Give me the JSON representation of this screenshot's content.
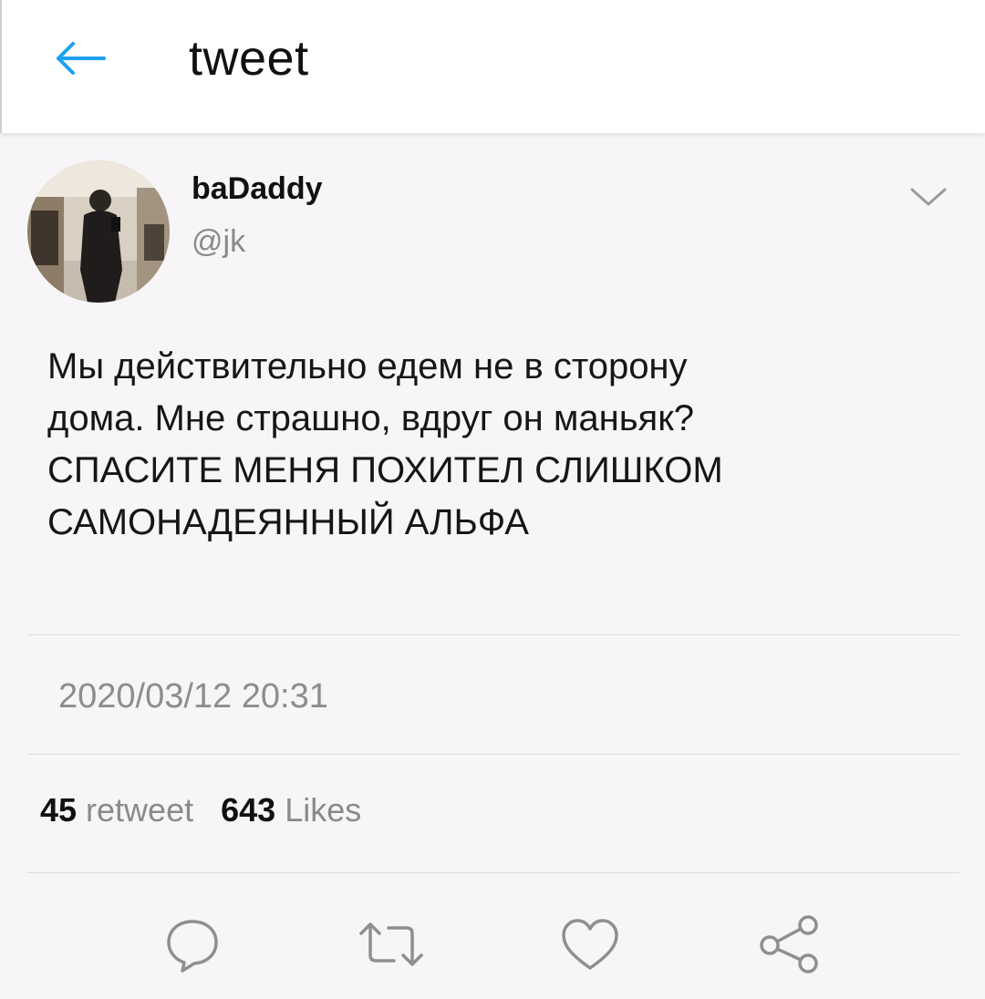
{
  "header": {
    "title": "tweet",
    "back_icon": "back-arrow-icon",
    "accent_color": "#1da1f2"
  },
  "tweet": {
    "author": {
      "display_name": "baDaddy",
      "handle": "@jk"
    },
    "text": "Мы действительно едем не в сторону\nдома. Мне страшно, вдруг он маньяк?\nСПАСИТЕ МЕНЯ ПОХИТЕЛ СЛИШКОМ\nСАМОНАДЕЯННЫЙ АЛЬФА",
    "timestamp": "2020/03/12 20:31",
    "stats": {
      "retweet_count": "45",
      "retweet_label": "retweet",
      "likes_count": "643",
      "likes_label": "Likes"
    },
    "actions": [
      {
        "name": "reply",
        "icon": "reply-icon"
      },
      {
        "name": "retweet",
        "icon": "retweet-icon"
      },
      {
        "name": "like",
        "icon": "heart-icon"
      },
      {
        "name": "share",
        "icon": "share-icon"
      }
    ]
  }
}
